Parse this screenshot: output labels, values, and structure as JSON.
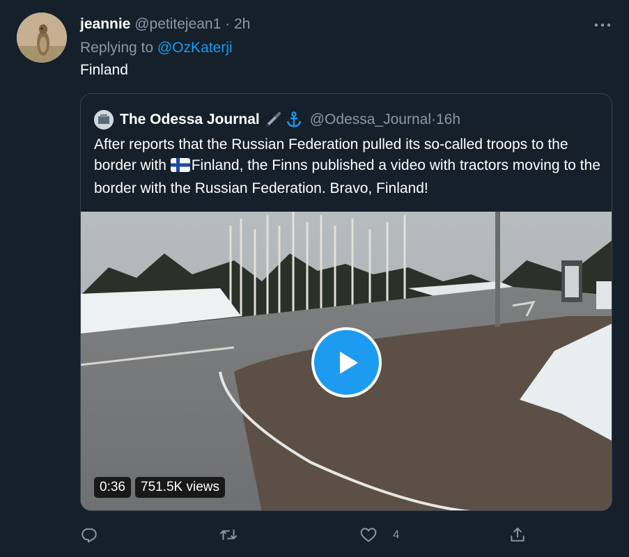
{
  "tweet": {
    "author_name": "jeannie",
    "author_handle": "@petitejean1",
    "separator": "·",
    "time": "2h",
    "replying_prefix": "Replying to",
    "replying_to": "@OzKaterji",
    "text": "Finland",
    "more_icon": "more-dots-icon"
  },
  "quoted": {
    "author_name": "The Odessa Journal",
    "emojis": [
      "pen-emoji",
      "anchor-emoji"
    ],
    "author_handle": "@Odessa_Journal",
    "separator": "·",
    "time": "16h",
    "text_before_flag": "After reports that the Russian Federation pulled its so-called troops to the border with ",
    "flag": "finland-flag",
    "text_after_flag": "Finland, the Finns published a video with tractors moving to the border with the Russian Federation. Bravo, Finland!",
    "video": {
      "duration": "0:36",
      "views": "751.5K views"
    }
  },
  "actions": {
    "reply_icon": "reply-icon",
    "retweet_icon": "retweet-icon",
    "like_icon": "heart-icon",
    "like_count": "4",
    "share_icon": "share-icon"
  },
  "colors": {
    "background": "#15202b",
    "accent": "#1d9bf0",
    "secondary_text": "#8b98a5",
    "border": "#38444d"
  }
}
